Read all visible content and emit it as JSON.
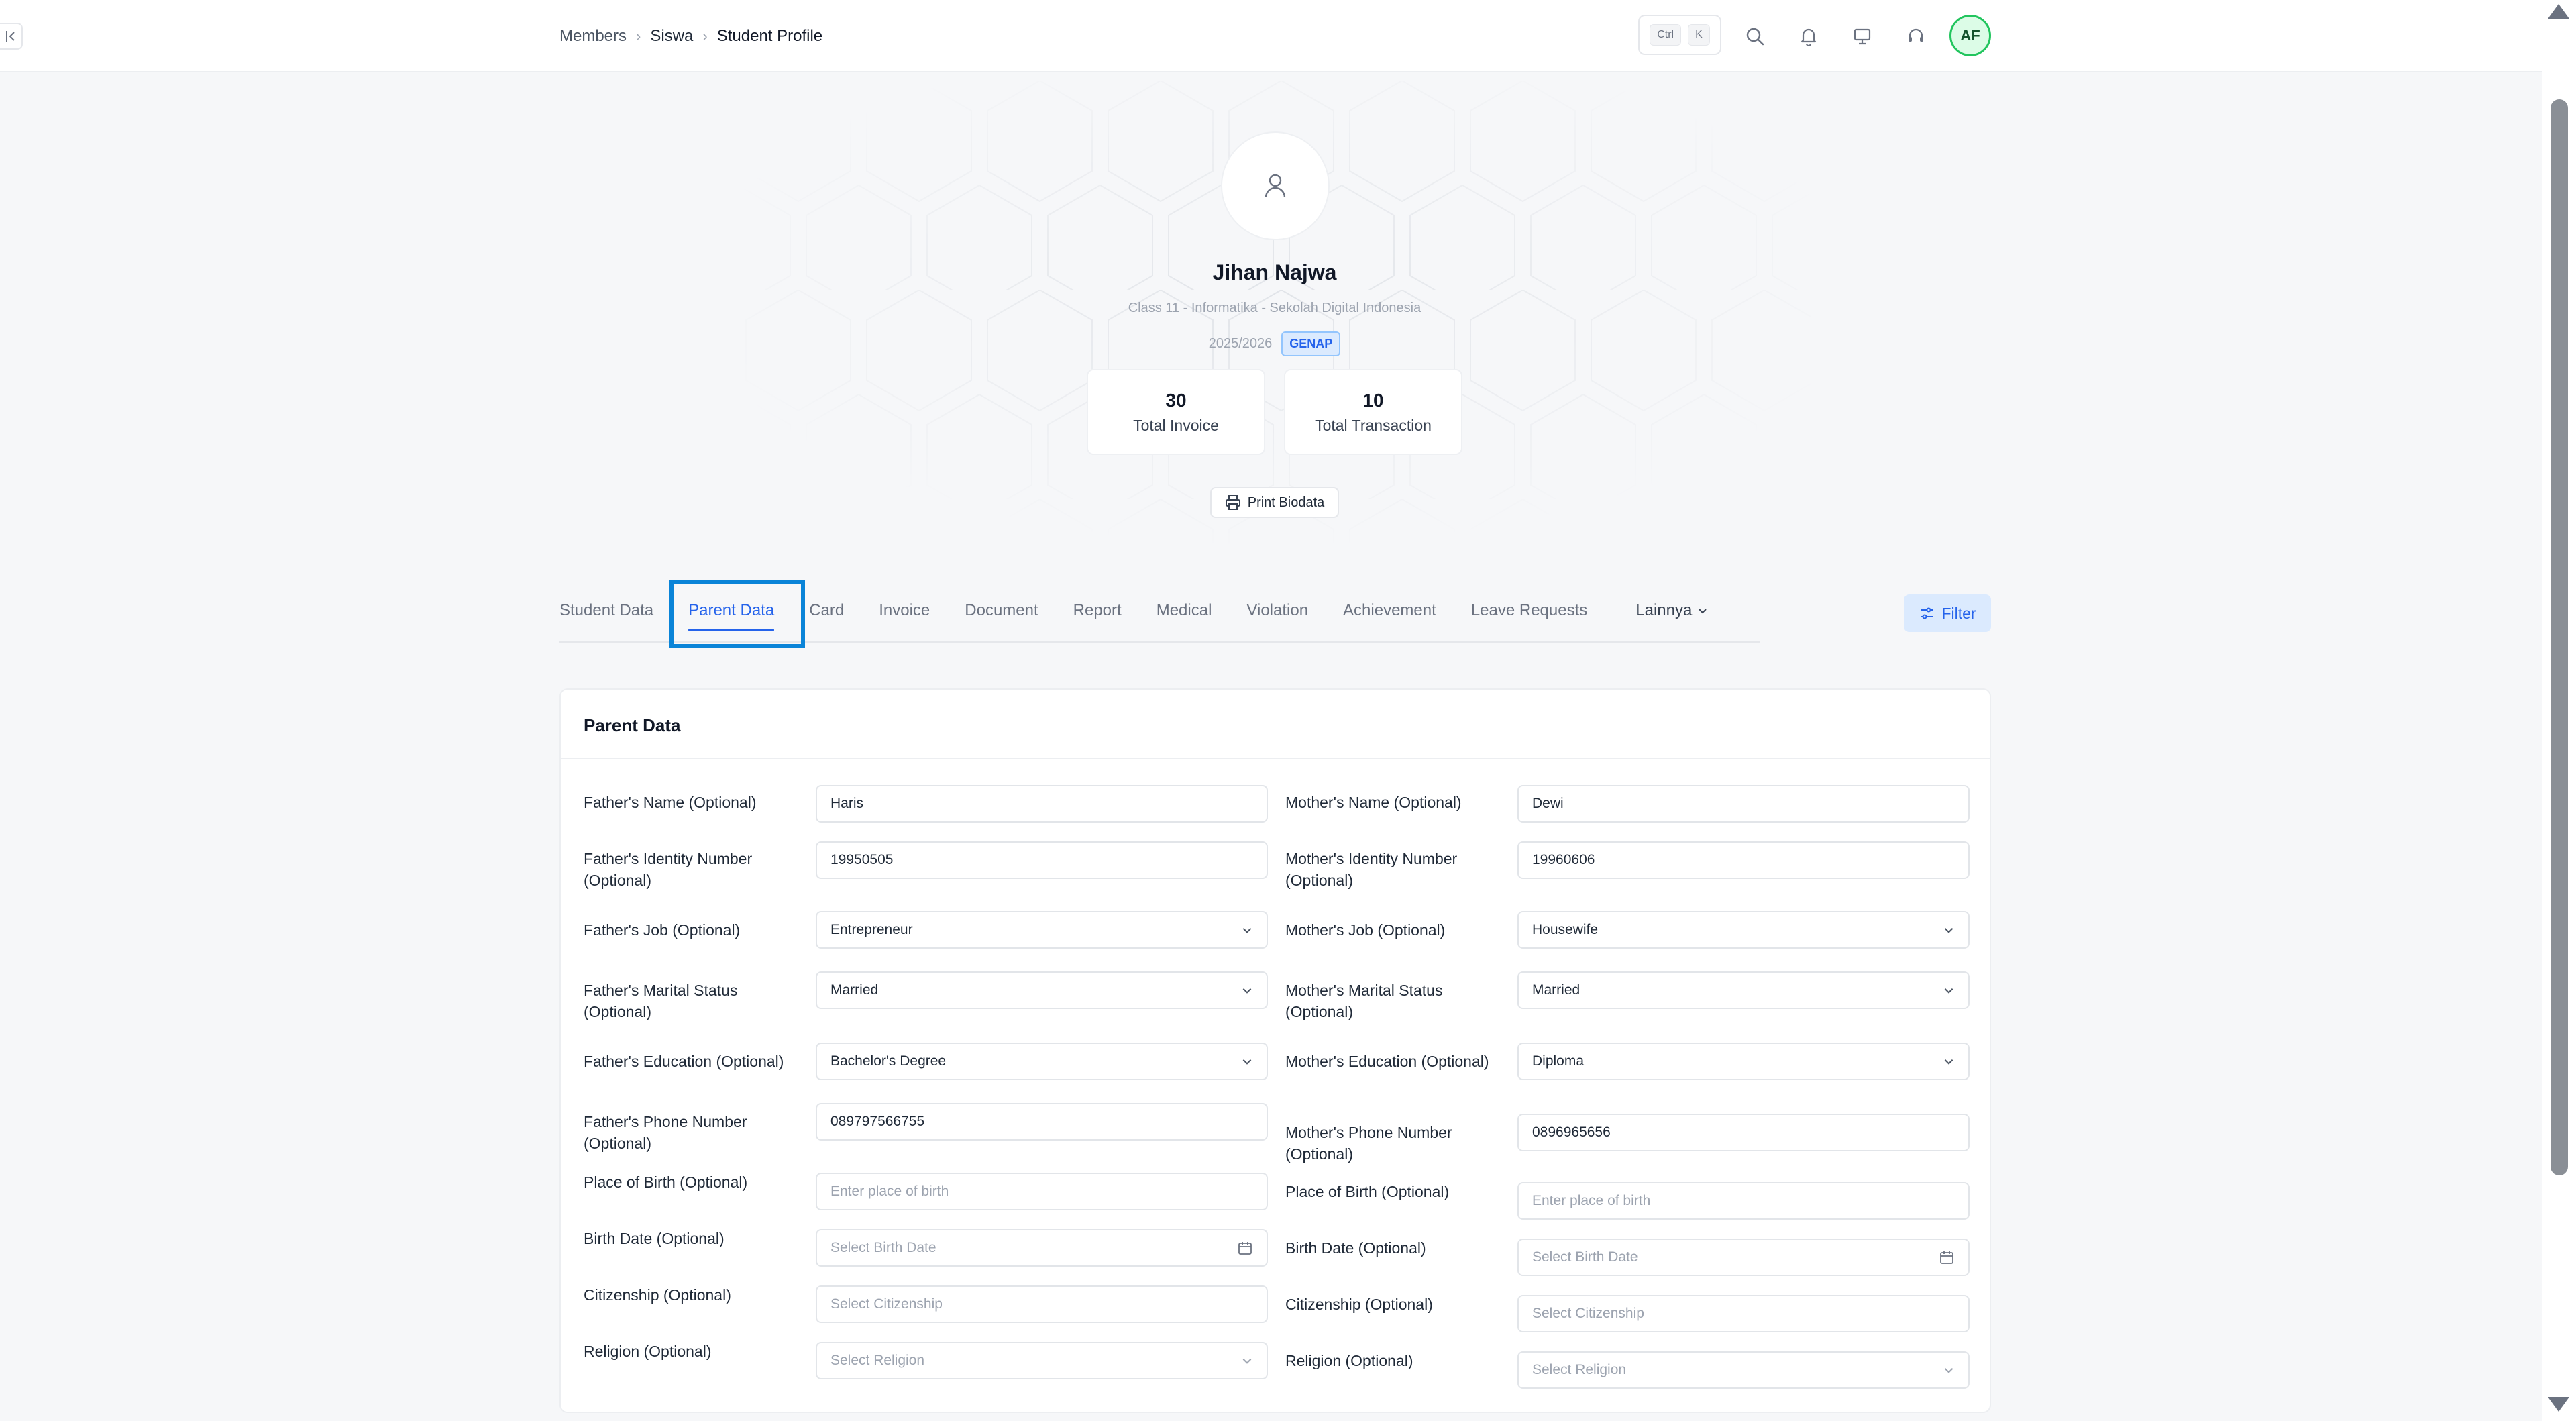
{
  "breadcrumb": {
    "items": [
      "Members",
      "Siswa",
      "Student Profile"
    ]
  },
  "header": {
    "shortcut_ctrl": "Ctrl",
    "shortcut_key": "K",
    "avatar_initials": "AF"
  },
  "profile": {
    "name": "Jihan Najwa",
    "subtitle": "Class 11 - Informatika - Sekolah Digital Indonesia",
    "year": "2025/2026",
    "semester": "GENAP",
    "stats": [
      {
        "value": "30",
        "label": "Total Invoice"
      },
      {
        "value": "10",
        "label": "Total Transaction"
      }
    ],
    "print_label": "Print Biodata"
  },
  "tabs": {
    "items": [
      "Student Data",
      "Parent Data",
      "Card",
      "Invoice",
      "Document",
      "Report",
      "Medical",
      "Violation",
      "Achievement",
      "Leave Requests"
    ],
    "active": "Parent Data",
    "more_label": "Lainnya",
    "filter_label": "Filter"
  },
  "form": {
    "title": "Parent Data",
    "father": {
      "name": {
        "label": "Father's Name (Optional)",
        "value": "Haris"
      },
      "identity": {
        "label": "Father's Identity Number (Optional)",
        "value": "19950505"
      },
      "job": {
        "label": "Father's Job (Optional)",
        "value": "Entrepreneur"
      },
      "marital": {
        "label": "Father's Marital Status (Optional)",
        "value": "Married"
      },
      "education": {
        "label": "Father's Education (Optional)",
        "value": "Bachelor's Degree"
      },
      "phone": {
        "label": "Father's Phone Number (Optional)",
        "value": "089797566755"
      },
      "birth_place": {
        "label": "Place of Birth (Optional)",
        "placeholder": "Enter place of birth"
      },
      "birth_date": {
        "label": "Birth Date (Optional)",
        "placeholder": "Select Birth Date"
      },
      "citizenship": {
        "label": "Citizenship (Optional)",
        "placeholder": "Select Citizenship"
      },
      "religion": {
        "label": "Religion (Optional)",
        "placeholder": "Select Religion"
      }
    },
    "mother": {
      "name": {
        "label": "Mother's Name (Optional)",
        "value": "Dewi"
      },
      "identity": {
        "label": "Mother's Identity Number (Optional)",
        "value": "19960606"
      },
      "job": {
        "label": "Mother's Job (Optional)",
        "value": "Housewife"
      },
      "marital": {
        "label": "Mother's Marital Status (Optional)",
        "value": "Married"
      },
      "education": {
        "label": "Mother's Education (Optional)",
        "value": "Diploma"
      },
      "phone": {
        "label": "Mother's Phone Number (Optional)",
        "value": "0896965656"
      },
      "birth_place": {
        "label": "Place of Birth (Optional)",
        "placeholder": "Enter place of birth"
      },
      "birth_date": {
        "label": "Birth Date (Optional)",
        "placeholder": "Select Birth Date"
      },
      "citizenship": {
        "label": "Citizenship (Optional)",
        "placeholder": "Select Citizenship"
      },
      "religion": {
        "label": "Religion (Optional)",
        "placeholder": "Select Religion"
      }
    }
  },
  "colors": {
    "accent": "#2563eb",
    "highlight_box": "#0a84d8",
    "avatar_ring": "#22c55e"
  }
}
